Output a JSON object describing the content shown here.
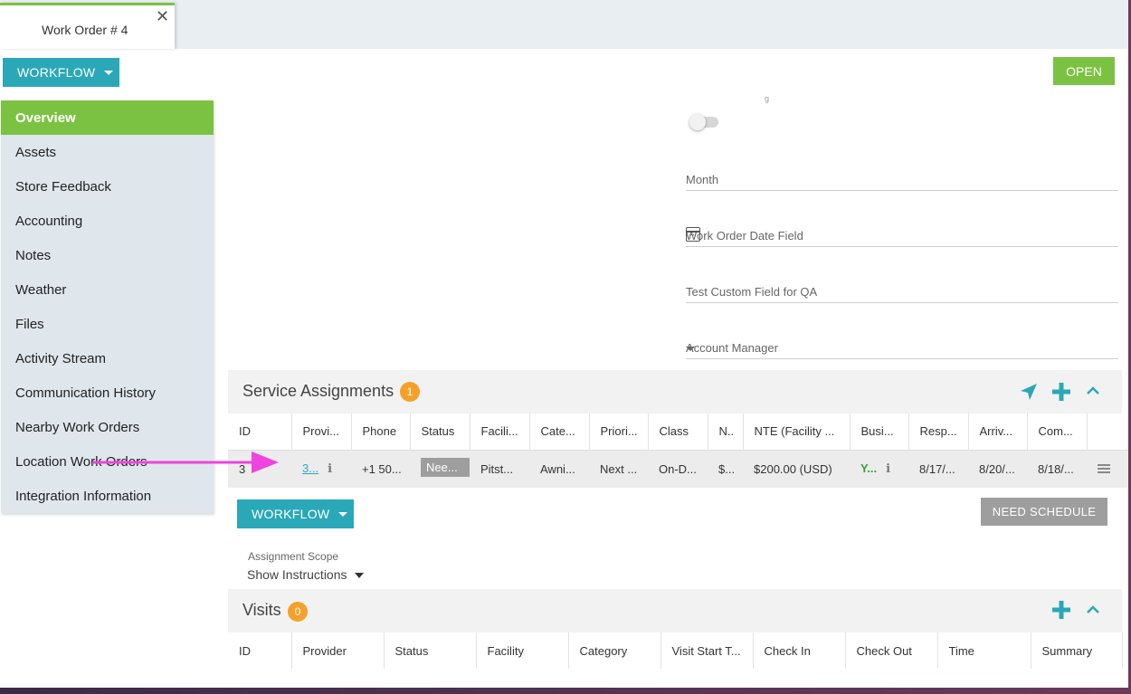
{
  "tab": {
    "title": "Work Order # 4",
    "close": "✕"
  },
  "workflow_label": "WORKFLOW",
  "status_button": "OPEN",
  "sidebar": {
    "items": [
      {
        "label": "Overview"
      },
      {
        "label": "Assets"
      },
      {
        "label": "Store Feedback"
      },
      {
        "label": "Accounting"
      },
      {
        "label": "Notes"
      },
      {
        "label": "Weather"
      },
      {
        "label": "Files"
      },
      {
        "label": "Activity Stream"
      },
      {
        "label": "Communication History"
      },
      {
        "label": "Nearby Work Orders"
      },
      {
        "label": "Location Work Orders"
      },
      {
        "label": "Integration Information"
      }
    ]
  },
  "form": {
    "partial_label": "g",
    "month_label": "Month",
    "date_field_label": "Work Order Date Field",
    "custom_field_label": "Test Custom Field for QA",
    "account_manager_label": "Account Manager"
  },
  "service_assignments": {
    "title": "Service Assignments",
    "count": "1",
    "columns": [
      "ID",
      "Provi...",
      "Phone",
      "Status",
      "Facili...",
      "Cate...",
      "Priori...",
      "Class",
      "N..",
      "NTE (Facility ...",
      "Busi...",
      "Resp...",
      "Arriv...",
      "Com..."
    ],
    "row": {
      "id": "3",
      "provider": "3...",
      "info": "i",
      "phone": "+1 50...",
      "status": "Nee...",
      "facility": "Pitst...",
      "category": "Awni...",
      "priority": "Next ...",
      "class": "On-D...",
      "n": "$...",
      "nte": "$200.00 (USD)",
      "business": "Y...",
      "response": "8/17/...",
      "arrival": "8/20/...",
      "completion": "8/18/..."
    },
    "need_schedule_button": "NEED SCHEDULE",
    "scope_label": "Assignment Scope",
    "show_instructions": "Show Instructions"
  },
  "visits": {
    "title": "Visits",
    "count": "0",
    "columns": [
      "ID",
      "Provider",
      "Status",
      "Facility",
      "Category",
      "Visit Start T...",
      "Check In",
      "Check Out",
      "Time",
      "Summary"
    ]
  },
  "colors": {
    "accent_teal": "#2aa8b8",
    "accent_green": "#7cc242",
    "badge_orange": "#f4a12a",
    "annotation_arrow": "#ee44dd"
  }
}
